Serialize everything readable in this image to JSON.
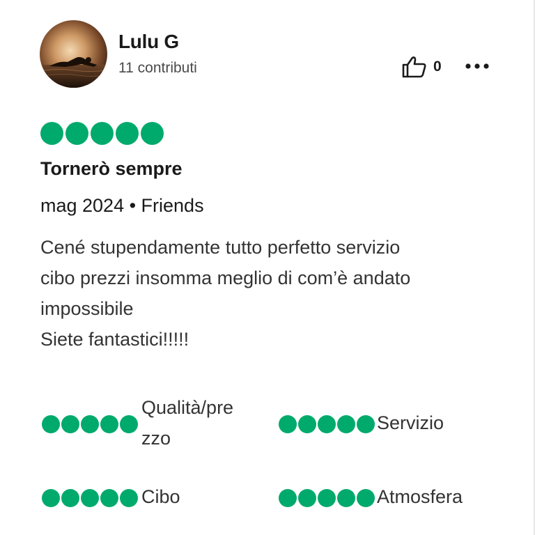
{
  "user": {
    "name": "Lulu G",
    "contributions": "11 contributi"
  },
  "helpful": {
    "count": "0"
  },
  "review": {
    "rating": 5,
    "title": "Tornerò sempre",
    "meta": "mag 2024 • Friends",
    "body": "Cené stupendamente tutto perfetto servizio\ncibo prezzi insomma meglio di com’è andato\nimpossibile\nSiete fantastici!!!!!"
  },
  "sub_ratings": [
    {
      "label": "Qualità/pre\nzzo",
      "rating": 5
    },
    {
      "label": "Servizio",
      "rating": 5
    },
    {
      "label": "Cibo",
      "rating": 5
    },
    {
      "label": "Atmosfera",
      "rating": 5
    }
  ],
  "colors": {
    "rating_green": "#00aa6c"
  },
  "icons": {
    "helpful": "thumbs-up-icon",
    "more": "more-horizontal-icon"
  }
}
